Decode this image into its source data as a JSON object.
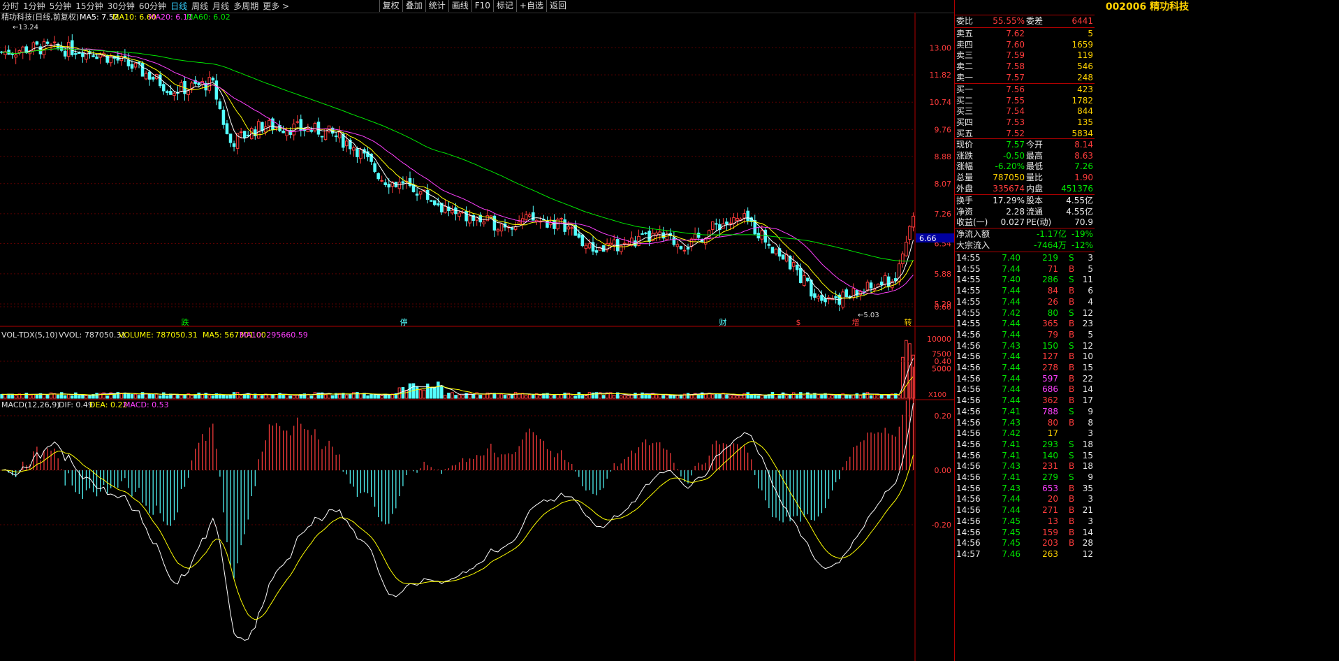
{
  "tabs": [
    "分时",
    "1分钟",
    "5分钟",
    "15分钟",
    "30分钟",
    "60分钟",
    "日线",
    "周线",
    "月线",
    "多周期",
    "更多"
  ],
  "active_tab": "日线",
  "more_arrow": ">",
  "tools": [
    "复权",
    "叠加",
    "统计",
    "画线",
    "F10",
    "标记",
    "+自选",
    "返回"
  ],
  "legend_main": {
    "name": "精功科技(日线,前复权)",
    "ma5": "MA5: 7.52",
    "ma10": "MA10: 6.60",
    "ma20": "MA20: 6.11",
    "ma60": "MA60: 6.02"
  },
  "legend_vol": {
    "name": "VOL-TDX(5,10)",
    "vvol": "VVOL: 787050.31",
    "volume": "VOLUME: 787050.31",
    "ma5": "MA5: 567301.00",
    "ma10": "MA10: 295660.59"
  },
  "legend_macd": {
    "name": "MACD(12,26,9)",
    "dif": "DIF: 0.49",
    "dea": "DEA: 0.22",
    "macd": "MACD: 0.53"
  },
  "price_axis": [
    "13.00",
    "11.82",
    "10.74",
    "9.76",
    "8.88",
    "8.07",
    "7.26",
    "6.54",
    "5.88",
    "5.29"
  ],
  "current_price_tag": "6.66",
  "vol_axis": [
    "10000",
    "7500",
    "5000"
  ],
  "vol_unit": "X100",
  "macd_axis": [
    "0.60",
    "0.40",
    "0.20",
    "0.00",
    "-0.20"
  ],
  "annot_high": "13.24",
  "annot_low": "5.03",
  "event_marks": [
    "跌",
    "停",
    "财",
    "$",
    "增",
    "转"
  ],
  "stock": {
    "code": "002006",
    "name": "精功科技"
  },
  "weibi": {
    "label1": "委比",
    "v1": "55.55%",
    "label2": "委差",
    "v2": "6441"
  },
  "asks": [
    {
      "label": "卖五",
      "price": "7.62",
      "vol": "5"
    },
    {
      "label": "卖四",
      "price": "7.60",
      "vol": "1659"
    },
    {
      "label": "卖三",
      "price": "7.59",
      "vol": "119"
    },
    {
      "label": "卖二",
      "price": "7.58",
      "vol": "546"
    },
    {
      "label": "卖一",
      "price": "7.57",
      "vol": "248"
    }
  ],
  "bids": [
    {
      "label": "买一",
      "price": "7.56",
      "vol": "423"
    },
    {
      "label": "买二",
      "price": "7.55",
      "vol": "1782"
    },
    {
      "label": "买三",
      "price": "7.54",
      "vol": "844"
    },
    {
      "label": "买四",
      "price": "7.53",
      "vol": "135"
    },
    {
      "label": "买五",
      "price": "7.52",
      "vol": "5834"
    }
  ],
  "quote": [
    {
      "l1": "现价",
      "v1": "7.57",
      "c1": "g",
      "l2": "今开",
      "v2": "8.14",
      "c2": "r"
    },
    {
      "l1": "涨跌",
      "v1": "-0.50",
      "c1": "g",
      "l2": "最高",
      "v2": "8.63",
      "c2": "r"
    },
    {
      "l1": "涨幅",
      "v1": "-6.20%",
      "c1": "g",
      "l2": "最低",
      "v2": "7.26",
      "c2": "g"
    },
    {
      "l1": "总量",
      "v1": "787050",
      "c1": "y",
      "l2": "量比",
      "v2": "1.90",
      "c2": "r"
    },
    {
      "l1": "外盘",
      "v1": "335674",
      "c1": "r",
      "l2": "内盘",
      "v2": "451376",
      "c2": "g"
    }
  ],
  "fin": [
    {
      "l1": "换手",
      "v1": "17.29%",
      "l2": "股本",
      "v2": "4.55亿"
    },
    {
      "l1": "净资",
      "v1": "2.28",
      "l2": "流通",
      "v2": "4.55亿"
    },
    {
      "l1": "收益(一)",
      "v1": "0.027",
      "l2": "PE(动)",
      "v2": "70.9"
    }
  ],
  "flow": [
    {
      "label": "净流入额",
      "v1": "-1.17亿",
      "v2": "-19%"
    },
    {
      "label": "大宗流入",
      "v1": "-7464万",
      "v2": "-12%"
    }
  ],
  "ticks": [
    {
      "t": "14:55",
      "p": "7.40",
      "v": "219",
      "d": "S",
      "n": "3"
    },
    {
      "t": "14:55",
      "p": "7.44",
      "v": "71",
      "d": "B",
      "n": "5"
    },
    {
      "t": "14:55",
      "p": "7.40",
      "v": "286",
      "d": "S",
      "n": "11"
    },
    {
      "t": "14:55",
      "p": "7.44",
      "v": "84",
      "d": "B",
      "n": "6"
    },
    {
      "t": "14:55",
      "p": "7.44",
      "v": "26",
      "d": "B",
      "n": "4"
    },
    {
      "t": "14:55",
      "p": "7.42",
      "v": "80",
      "d": "S",
      "n": "12"
    },
    {
      "t": "14:55",
      "p": "7.44",
      "v": "365",
      "d": "B",
      "n": "23"
    },
    {
      "t": "14:56",
      "p": "7.44",
      "v": "79",
      "d": "B",
      "n": "5"
    },
    {
      "t": "14:56",
      "p": "7.43",
      "v": "150",
      "d": "S",
      "n": "12"
    },
    {
      "t": "14:56",
      "p": "7.44",
      "v": "127",
      "d": "B",
      "n": "10"
    },
    {
      "t": "14:56",
      "p": "7.44",
      "v": "278",
      "d": "B",
      "n": "15"
    },
    {
      "t": "14:56",
      "p": "7.44",
      "v": "597",
      "d": "B",
      "n": "22"
    },
    {
      "t": "14:56",
      "p": "7.44",
      "v": "686",
      "d": "B",
      "n": "14"
    },
    {
      "t": "14:56",
      "p": "7.44",
      "v": "362",
      "d": "B",
      "n": "17"
    },
    {
      "t": "14:56",
      "p": "7.41",
      "v": "788",
      "d": "S",
      "n": "9"
    },
    {
      "t": "14:56",
      "p": "7.43",
      "v": "80",
      "d": "B",
      "n": "8"
    },
    {
      "t": "14:56",
      "p": "7.42",
      "v": "17",
      "d": "",
      "n": "3"
    },
    {
      "t": "14:56",
      "p": "7.41",
      "v": "293",
      "d": "S",
      "n": "18"
    },
    {
      "t": "14:56",
      "p": "7.41",
      "v": "140",
      "d": "S",
      "n": "15"
    },
    {
      "t": "14:56",
      "p": "7.43",
      "v": "231",
      "d": "B",
      "n": "18"
    },
    {
      "t": "14:56",
      "p": "7.41",
      "v": "279",
      "d": "S",
      "n": "9"
    },
    {
      "t": "14:56",
      "p": "7.43",
      "v": "653",
      "d": "B",
      "n": "35"
    },
    {
      "t": "14:56",
      "p": "7.44",
      "v": "20",
      "d": "B",
      "n": "3"
    },
    {
      "t": "14:56",
      "p": "7.44",
      "v": "271",
      "d": "B",
      "n": "21"
    },
    {
      "t": "14:56",
      "p": "7.45",
      "v": "13",
      "d": "B",
      "n": "3"
    },
    {
      "t": "14:56",
      "p": "7.45",
      "v": "159",
      "d": "B",
      "n": "14"
    },
    {
      "t": "14:56",
      "p": "7.45",
      "v": "203",
      "d": "B",
      "n": "28"
    },
    {
      "t": "14:57",
      "p": "7.46",
      "v": "263",
      "d": "",
      "n": "12"
    }
  ],
  "colors": {
    "up": "#ff3c3c",
    "down": "#54ffff",
    "ma5": "#ffffff",
    "ma10": "#ffff00",
    "ma20": "#ff40ff",
    "ma60": "#00e600",
    "axis": "#b00000",
    "price_text": "#ff3c3c"
  }
}
